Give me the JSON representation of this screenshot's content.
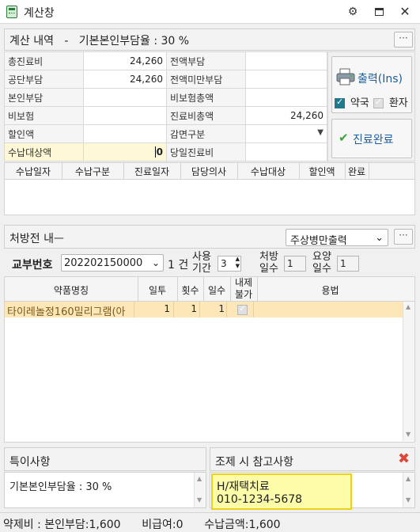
{
  "window": {
    "title": "계산창"
  },
  "summary": {
    "header": "계산 내역   -   기본본인부담율 : 30 %",
    "rows": [
      {
        "l1": "총진료비",
        "v1": "24,260",
        "l2": "전액부담",
        "v2": ""
      },
      {
        "l1": "공단부담",
        "v1": "24,260",
        "l2": "전액미만부담",
        "v2": ""
      },
      {
        "l1": "본인부담",
        "v1": "",
        "l2": "비보험총액",
        "v2": ""
      },
      {
        "l1": "비보험",
        "v1": "",
        "l2": "진료비총액",
        "v2": "24,260"
      },
      {
        "l1": "할인액",
        "v1": "",
        "l2": "감면구분",
        "v2": ""
      },
      {
        "l1": "수납대상액",
        "v1": "0",
        "l2": "당일진료비",
        "v2": ""
      }
    ],
    "print_button": "출력(Ins)",
    "chk_pharmacy": "약국",
    "chk_patient": "환자",
    "complete_button": "진료완료"
  },
  "payment_table": {
    "columns": [
      "수납일자",
      "수납구분",
      "진료일자",
      "담당의사",
      "수납대상",
      "할인액",
      "완료"
    ]
  },
  "prescription": {
    "header": "처방전 내ᅳ",
    "print_option": "주상병만출력",
    "ref_label": "교부번호",
    "ref_value": "202202150000",
    "count": "1 건",
    "use_period_label": "사용\n기간",
    "use_period_value": "3",
    "rx_days_label": "처방\n일수",
    "rx_days_value": "1",
    "care_days_label": "요양\n일수",
    "care_days_value": "1",
    "columns": [
      "약품명칭",
      "일투",
      "횟수",
      "일수",
      "내제\n불가",
      "용법"
    ],
    "rows": [
      {
        "name": "타이레놀정160밀리그램(아",
        "daily": "1",
        "times": "1",
        "days": "1",
        "usage": ""
      }
    ]
  },
  "notes": {
    "special_title": "특이사항",
    "special_text": "기본본인부담율 : 30 %",
    "ref_title": "조제 시 참고사항",
    "ref_line1": "H/재택치료",
    "ref_line2": "010-1234-5678"
  },
  "status": {
    "text": "약제비 : 본인부담:1,600      비급여:0      수납금액:1,600"
  },
  "icons": {
    "gear": "gear-icon",
    "restore": "restore-icon",
    "close": "close-icon",
    "printer": "printer-icon",
    "check": "check-icon",
    "delete": "delete-x-icon"
  },
  "colors": {
    "highlight_row": "#fde7b8",
    "yellow_field": "#fff8d8",
    "note_highlight": "#fdfca8",
    "accent_teal": "#1f7a8c",
    "delete_red": "#e0453a"
  }
}
